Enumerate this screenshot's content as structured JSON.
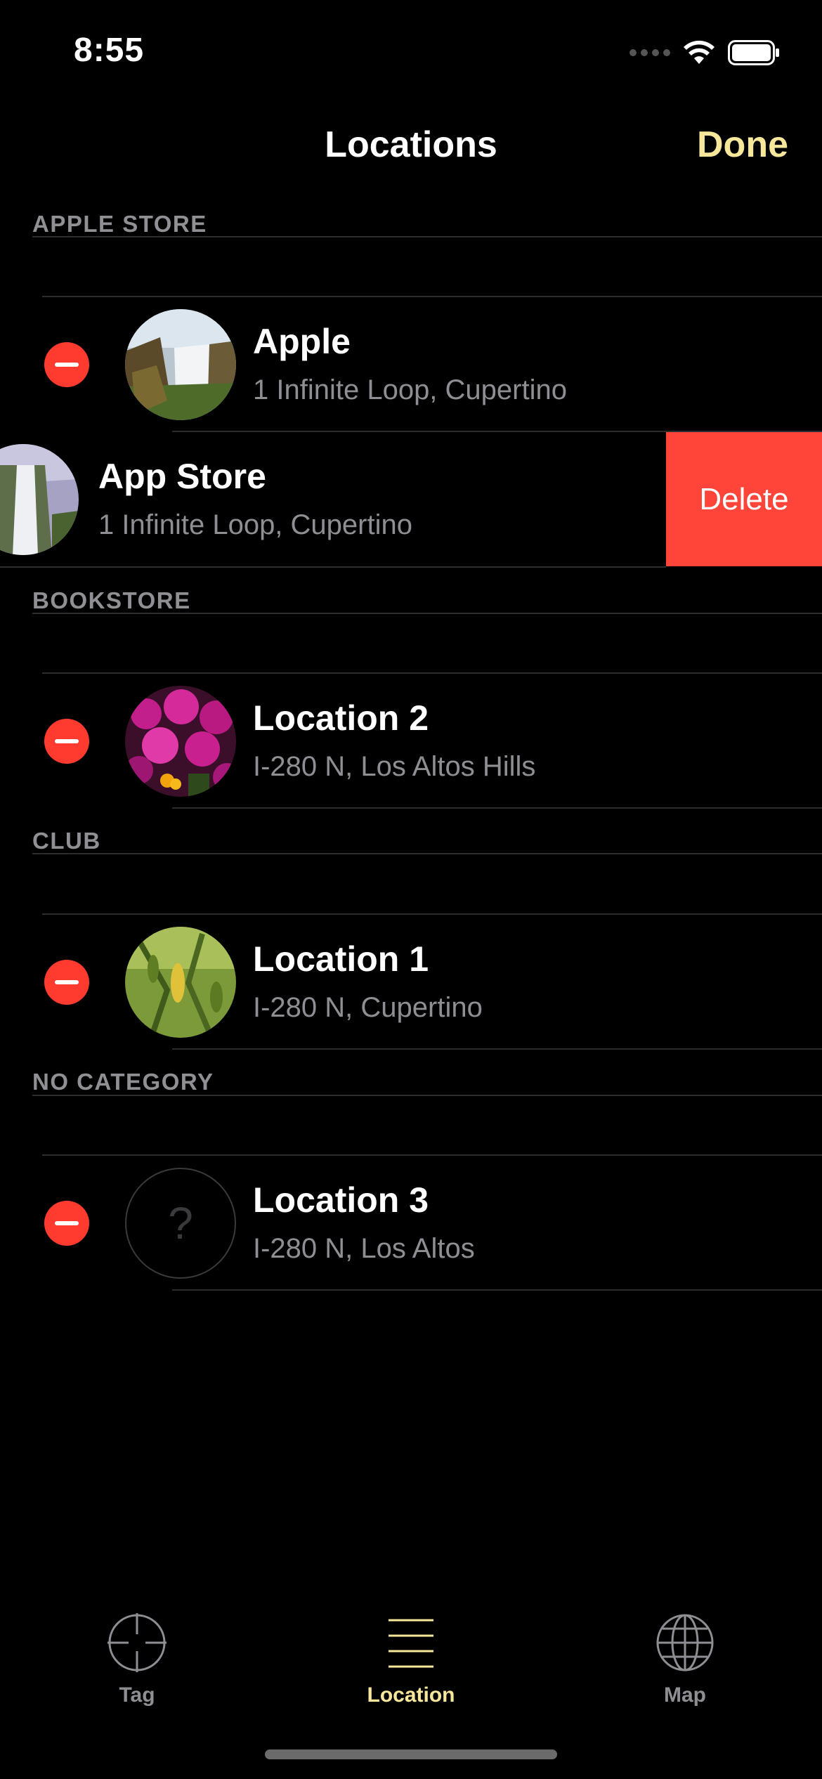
{
  "status_bar": {
    "time": "8:55"
  },
  "nav": {
    "title": "Locations",
    "done_label": "Done"
  },
  "sections": [
    {
      "header": "APPLE STORE",
      "rows": [
        {
          "title": "Apple",
          "subtitle": "1 Infinite Loop, Cupertino",
          "image": "waterfall-photo"
        },
        {
          "title": "App Store",
          "subtitle": "1 Infinite Loop, Cupertino",
          "image": "waterfall-photo",
          "swiped": true,
          "delete_label": "Delete"
        }
      ]
    },
    {
      "header": "BOOKSTORE",
      "rows": [
        {
          "title": "Location 2",
          "subtitle": "I-280 N, Los Altos Hills",
          "image": "flowers-photo"
        }
      ]
    },
    {
      "header": "CLUB",
      "rows": [
        {
          "title": "Location 1",
          "subtitle": "I-280 N, Cupertino",
          "image": "leaves-photo"
        }
      ]
    },
    {
      "header": "NO CATEGORY",
      "rows": [
        {
          "title": "Location 3",
          "subtitle": "I-280 N, Los Altos",
          "image": "question-mark-icon",
          "placeholder": "?"
        }
      ]
    }
  ],
  "tabs": [
    {
      "label": "Tag",
      "icon": "crosshair-icon",
      "selected": false
    },
    {
      "label": "Location",
      "icon": "list-lines-icon",
      "selected": true
    },
    {
      "label": "Map",
      "icon": "globe-icon",
      "selected": false
    }
  ],
  "colors": {
    "accent": "#f6e79a",
    "destructive": "#ff3b30",
    "delete_bg": "#ff453a",
    "inactive": "#8e8e93"
  }
}
